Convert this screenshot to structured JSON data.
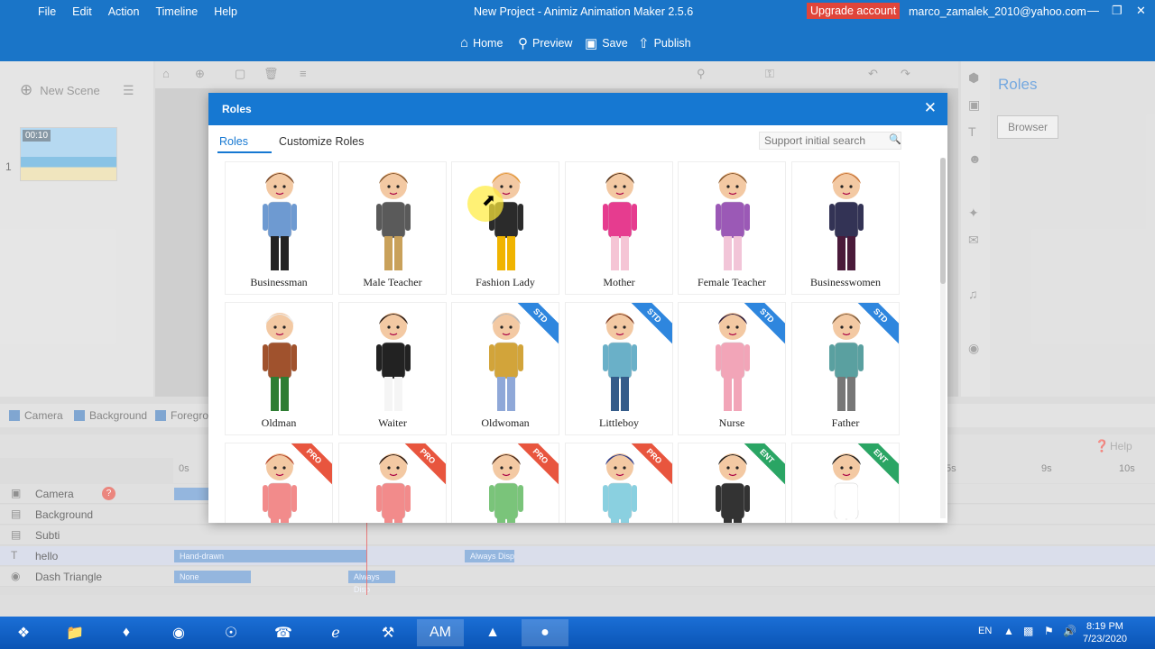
{
  "menu": [
    "File",
    "Edit",
    "Action",
    "Timeline",
    "Help"
  ],
  "app_title": "New Project - Animiz Animation Maker 2.5.6",
  "upgrade_label": "Upgrade account",
  "user_email": "marco_zamalek_2010@yahoo.com",
  "toolbar": {
    "home": "Home",
    "preview": "Preview",
    "save": "Save",
    "publish": "Publish"
  },
  "left": {
    "new_scene": "New Scene",
    "scene_number": "1",
    "scene_time": "00:10"
  },
  "right_panel": {
    "title": "Roles",
    "browser_button": "Browser"
  },
  "layer_tabs": {
    "camera": "Camera",
    "background": "Background",
    "foreground": "Foregro"
  },
  "help_label": "Help",
  "ruler": [
    "0s",
    "5s",
    "9s",
    "10s"
  ],
  "tracks": [
    {
      "name": "Camera",
      "icon": "camera-icon"
    },
    {
      "name": "Background",
      "icon": "background-icon"
    },
    {
      "name": "Subti",
      "icon": "subtitle-icon"
    },
    {
      "name": "hello",
      "icon": "text-icon"
    },
    {
      "name": "Dash Triangle",
      "icon": "shape-icon"
    }
  ],
  "track_bars": {
    "hand_drawn": "Hand-drawn",
    "always_disp1": "Always Disp",
    "none": "None",
    "always_disp2": "Always Disp"
  },
  "modal": {
    "title": "Roles",
    "tabs": [
      "Roles",
      "Customize Roles"
    ],
    "search_placeholder": "Support initial search",
    "roles": [
      {
        "name": "Businessman",
        "badge": "",
        "skin": "#f3c9a3",
        "hair": "#7b4b2a",
        "top": "#6e9ad1",
        "bottom": "#222222"
      },
      {
        "name": "Male Teacher",
        "badge": "",
        "skin": "#f3c9a3",
        "hair": "#8a5a2f",
        "top": "#5a5a5a",
        "bottom": "#c9a15a"
      },
      {
        "name": "Fashion Lady",
        "badge": "",
        "skin": "#f3c9a3",
        "hair": "#e39a3c",
        "top": "#2b2b2b",
        "bottom": "#f0b400"
      },
      {
        "name": "Mother",
        "badge": "",
        "skin": "#f3c9a3",
        "hair": "#5a3a22",
        "top": "#e63c8f",
        "bottom": "#f5c5d5"
      },
      {
        "name": "Female Teacher",
        "badge": "",
        "skin": "#f3c9a3",
        "hair": "#8a5a2f",
        "top": "#9b59b6",
        "bottom": "#f2c5d8"
      },
      {
        "name": "Businesswomen",
        "badge": "",
        "skin": "#f3c9a3",
        "hair": "#c9773a",
        "top": "#333355",
        "bottom": "#4a1a3a"
      },
      {
        "name": "Oldman",
        "badge": "",
        "skin": "#f3c9a3",
        "hair": "#eeeeee",
        "top": "#a0522d",
        "bottom": "#2e7d32"
      },
      {
        "name": "Waiter",
        "badge": "",
        "skin": "#f3c9a3",
        "hair": "#2b1a12",
        "top": "#222222",
        "bottom": "#f5f5f5"
      },
      {
        "name": "Oldwoman",
        "badge": "STD",
        "skin": "#f3c9a3",
        "hair": "#bbbbbb",
        "top": "#d2a43a",
        "bottom": "#8fa8d8"
      },
      {
        "name": "Littleboy",
        "badge": "STD",
        "skin": "#f3c9a3",
        "hair": "#7b3a22",
        "top": "#6ab0c8",
        "bottom": "#355c8a"
      },
      {
        "name": "Nurse",
        "badge": "STD",
        "skin": "#f3c9a3",
        "hair": "#2b1a3a",
        "top": "#f2a5b8",
        "bottom": "#f2a5b8"
      },
      {
        "name": "Father",
        "badge": "STD",
        "skin": "#f3c9a3",
        "hair": "#7b5a3a",
        "top": "#5aa0a0",
        "bottom": "#777777"
      },
      {
        "name": "",
        "badge": "PRO",
        "skin": "#f3c9a3",
        "hair": "#b5472a",
        "top": "#f28b8b",
        "bottom": "#f28b8b"
      },
      {
        "name": "",
        "badge": "PRO",
        "skin": "#f3c9a3",
        "hair": "#2b1a12",
        "top": "#f28b8b",
        "bottom": "#f28b8b"
      },
      {
        "name": "",
        "badge": "PRO",
        "skin": "#f3c9a3",
        "hair": "#4a2a1a",
        "top": "#7ac47a",
        "bottom": "#7ac47a"
      },
      {
        "name": "",
        "badge": "PRO",
        "skin": "#f3c9a3",
        "hair": "#2b3a8a",
        "top": "#8ad0e0",
        "bottom": "#8ad0e0"
      },
      {
        "name": "",
        "badge": "ENT",
        "skin": "#f3c9a3",
        "hair": "#1a1a1a",
        "top": "#333333",
        "bottom": "#333333"
      },
      {
        "name": "",
        "badge": "ENT",
        "skin": "#f3c9a3",
        "hair": "#1a1a1a",
        "top": "#ffffff",
        "bottom": "#ffffff"
      }
    ]
  },
  "taskbar": {
    "lang": "EN",
    "time": "8:19 PM",
    "date": "7/23/2020",
    "apps": [
      "start-icon",
      "explorer-icon",
      "kleopatra-icon",
      "firefox-icon",
      "chrome-icon",
      "whatsapp-icon",
      "edge-icon",
      "tools-icon",
      "animiz-icon",
      "vlc-icon",
      "recorder-icon"
    ]
  },
  "colors": {
    "accent": "#1678d2",
    "upgrade": "#e0453a",
    "std": "#2e86de",
    "pro": "#e8553e",
    "ent": "#2aa564"
  }
}
